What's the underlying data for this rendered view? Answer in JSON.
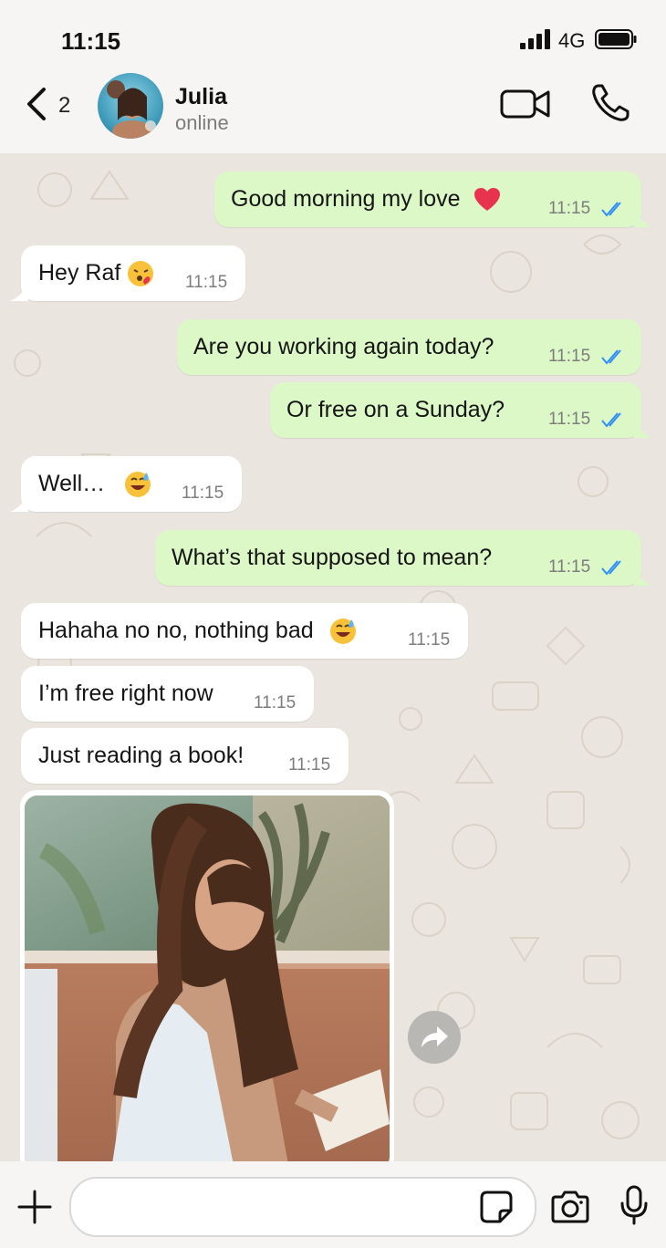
{
  "status_bar": {
    "time": "11:15",
    "network": "4G"
  },
  "header": {
    "back_count": "2",
    "contact_name": "Julia",
    "presence": "online"
  },
  "messages": [
    {
      "dir": "out",
      "text": "Good morning my love",
      "emoji": "heart",
      "time": "11:15",
      "read": true
    },
    {
      "dir": "in",
      "text": "Hey Raf",
      "emoji": "kissing-face",
      "time": "11:15"
    },
    {
      "dir": "out",
      "text": "Are you working again today?",
      "time": "11:15",
      "read": true
    },
    {
      "dir": "out",
      "text": "Or free on a Sunday?",
      "time": "11:15",
      "read": true
    },
    {
      "dir": "in",
      "text": "Well…",
      "emoji": "grinning-sweat-face",
      "time": "11:15"
    },
    {
      "dir": "out",
      "text": "What’s that supposed to mean?",
      "time": "11:15",
      "read": true
    },
    {
      "dir": "in",
      "text": "Hahaha no no, nothing bad",
      "emoji": "grinning-sweat-face",
      "time": "11:15"
    },
    {
      "dir": "in",
      "text": "I’m free right now",
      "time": "11:15"
    },
    {
      "dir": "in",
      "text": "Just reading a book!",
      "time": "11:15"
    },
    {
      "dir": "in",
      "type": "photo",
      "subject": "woman reading a book"
    }
  ],
  "input": {
    "placeholder": ""
  },
  "icons": {
    "back": "chevron-left-icon",
    "video": "video-camera-icon",
    "call": "phone-icon",
    "attach": "plus-icon",
    "sticker": "sticker-icon",
    "camera": "camera-icon",
    "mic": "microphone-icon",
    "forward": "share-arrow-icon",
    "read": "double-check-icon"
  },
  "colors": {
    "outgoing_bubble": "#dcf8c6",
    "incoming_bubble": "#ffffff",
    "read_ticks": "#2f8ef7",
    "chat_background": "#eae6df"
  }
}
